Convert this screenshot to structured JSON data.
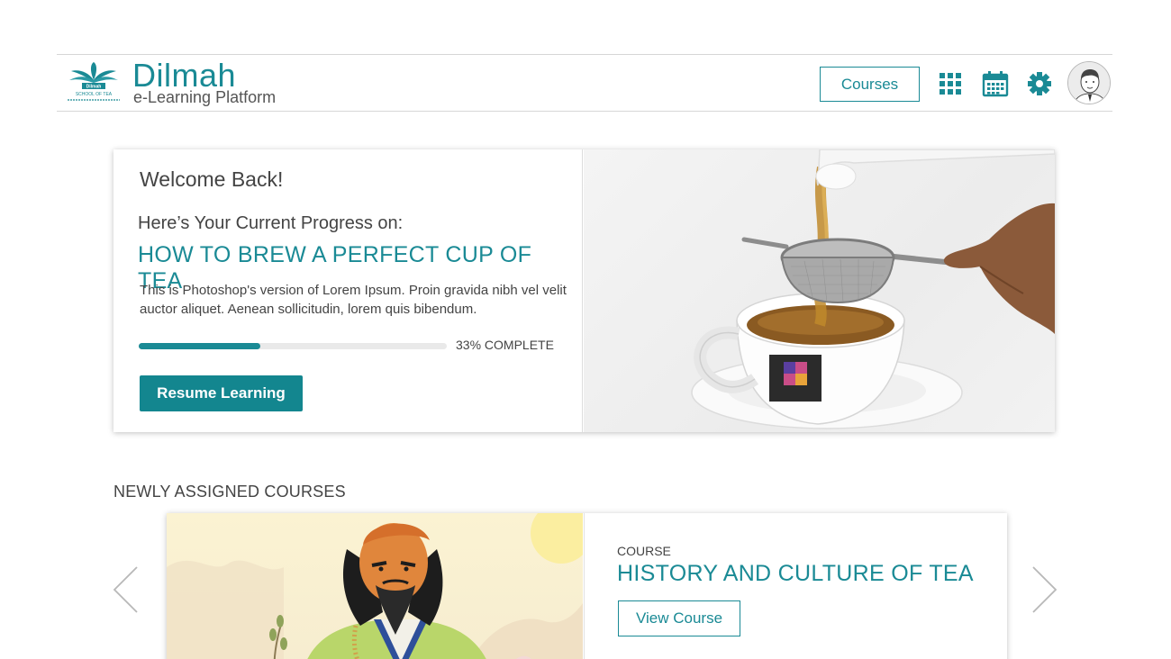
{
  "header": {
    "logo_text": "Dilmah",
    "logo_tagline": "SCHOOL OF TEA",
    "brand_name": "Dilmah",
    "brand_subtitle": "e-Learning Platform",
    "courses_label": "Courses",
    "icons": [
      "apps-grid-icon",
      "calendar-icon",
      "gear-icon",
      "avatar"
    ]
  },
  "progress": {
    "welcome": "Welcome Back!",
    "progress_on": "Here’s Your Current Progress on:",
    "course_title": "HOW TO BREW A PERFECT CUP OF TEA",
    "description": "This is Photoshop's version  of Lorem Ipsum. Proin gravida nibh vel velit auctor aliquet. Aenean sollicitudin, lorem quis bibendum.",
    "percent": 0.33,
    "percent_label": "33% COMPLETE",
    "resume_label": "Resume Learning"
  },
  "assigned": {
    "section_title": "NEWLY ASSIGNED COURSES",
    "course_kicker": "COURSE",
    "course_title": "HISTORY AND CULTURE OF TEA",
    "view_label": "View Course"
  },
  "colors": {
    "accent": "#1a8a95",
    "progress_track": "#e9e9e9"
  }
}
